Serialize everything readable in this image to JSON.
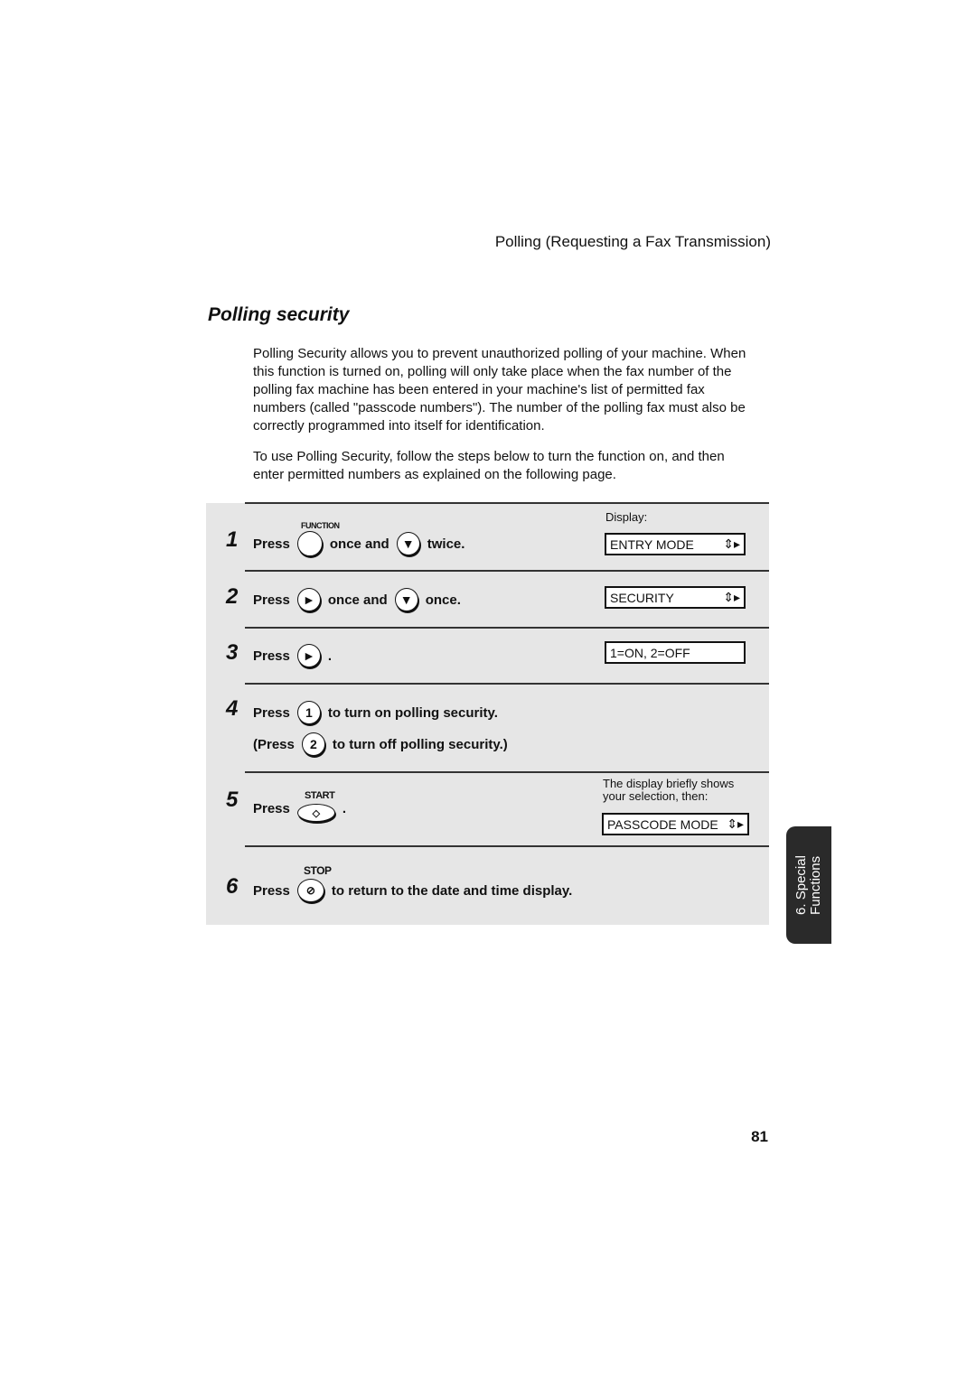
{
  "header": "Polling (Requesting a Fax Transmission)",
  "title": "Polling security",
  "paragraphs": [
    "Polling Security allows you to prevent unauthorized polling of your machine. When this function is turned on, polling will only take place when the fax number of the polling fax machine has been entered in your machine's list of permitted fax numbers (called \"passcode numbers\"). The number of the polling fax must also be correctly programmed into itself for identification.",
    "To use Polling Security, follow the steps below to turn the function on, and then enter permitted numbers as explained on the following page."
  ],
  "display_label": "Display:",
  "steps": [
    {
      "num": "1",
      "press": "Press",
      "key_label": "FUNCTION",
      "mid": "once and",
      "end": "twice.",
      "display": "ENTRY MODE"
    },
    {
      "num": "2",
      "press": "Press",
      "mid": "once and",
      "end": "once.",
      "display": "SECURITY"
    },
    {
      "num": "3",
      "press": "Press",
      "end": ".",
      "display": "1=ON, 2=OFF"
    },
    {
      "num": "4",
      "press": "Press",
      "key": "1",
      "end": "to turn on polling security.",
      "alt_press": "(Press",
      "alt_key": "2",
      "alt_end": "to turn off polling security.)"
    },
    {
      "num": "5",
      "press": "Press",
      "key_label": "START",
      "end": ".",
      "note": "The display briefly shows your selection, then:",
      "display": "PASSCODE MODE"
    },
    {
      "num": "6",
      "press": "Press",
      "key_label": "STOP",
      "end": "to return to the date and time display."
    }
  ],
  "side_tab": {
    "line1": "6. Special",
    "line2": "Functions"
  },
  "page_number": "81"
}
